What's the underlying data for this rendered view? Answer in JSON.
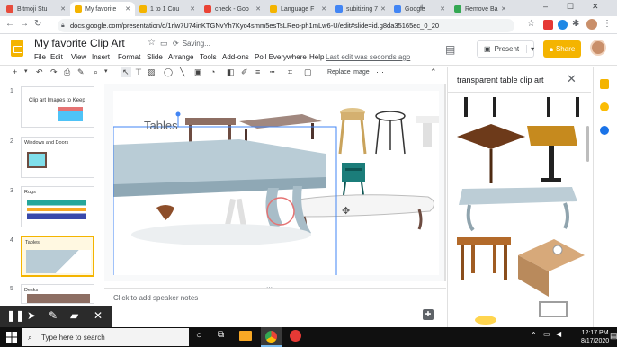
{
  "browser": {
    "tabs": [
      {
        "label": "Bitmoji Stu",
        "favicon_color": "#e74c3c",
        "active": false
      },
      {
        "label": "My favorite",
        "favicon_color": "#f4b400",
        "active": true
      },
      {
        "label": "1 to 1 Cou",
        "favicon_color": "#f4b400",
        "active": false
      },
      {
        "label": "check - Goo",
        "favicon_color": "#ea4335",
        "active": false
      },
      {
        "label": "Language F",
        "favicon_color": "#f4b400",
        "active": false
      },
      {
        "label": "subitizing 7",
        "favicon_color": "#4285f4",
        "active": false
      },
      {
        "label": "Google",
        "favicon_color": "#4285f4",
        "active": false
      },
      {
        "label": "Remove Ba",
        "favicon_color": "#34a853",
        "active": false
      }
    ],
    "url": "docs.google.com/presentation/d/1rlw7U74inKTGNvYh7Kyo4smm5esTsLReo-ph1mLw6-U/edit#slide=id.g8da35165ec_0_20"
  },
  "doc": {
    "title": "My favorite Clip Art",
    "status": "Saving...",
    "menu": [
      "File",
      "Edit",
      "View",
      "Insert",
      "Format",
      "Slide",
      "Arrange",
      "Tools",
      "Add-ons",
      "Poll Everywhere",
      "Help"
    ],
    "last_edit": "Last edit was seconds ago",
    "present_label": "Present",
    "share_label": "Share"
  },
  "toolbar": {
    "replace_image": "Replace image"
  },
  "slides": [
    {
      "num": "1",
      "title": "Clip art Images to Keep"
    },
    {
      "num": "2",
      "title": "Windows and Doors"
    },
    {
      "num": "3",
      "title": "Rugs"
    },
    {
      "num": "4",
      "title": "Tables"
    },
    {
      "num": "5",
      "title": "Desks"
    }
  ],
  "canvas": {
    "slide_title": "Tables",
    "notes_placeholder": "Click to add speaker notes"
  },
  "image_search": {
    "query": "transparent table clip art"
  },
  "taskbar": {
    "search_placeholder": "Type here to search",
    "time": "12:17 PM",
    "date": "8/17/2020"
  }
}
